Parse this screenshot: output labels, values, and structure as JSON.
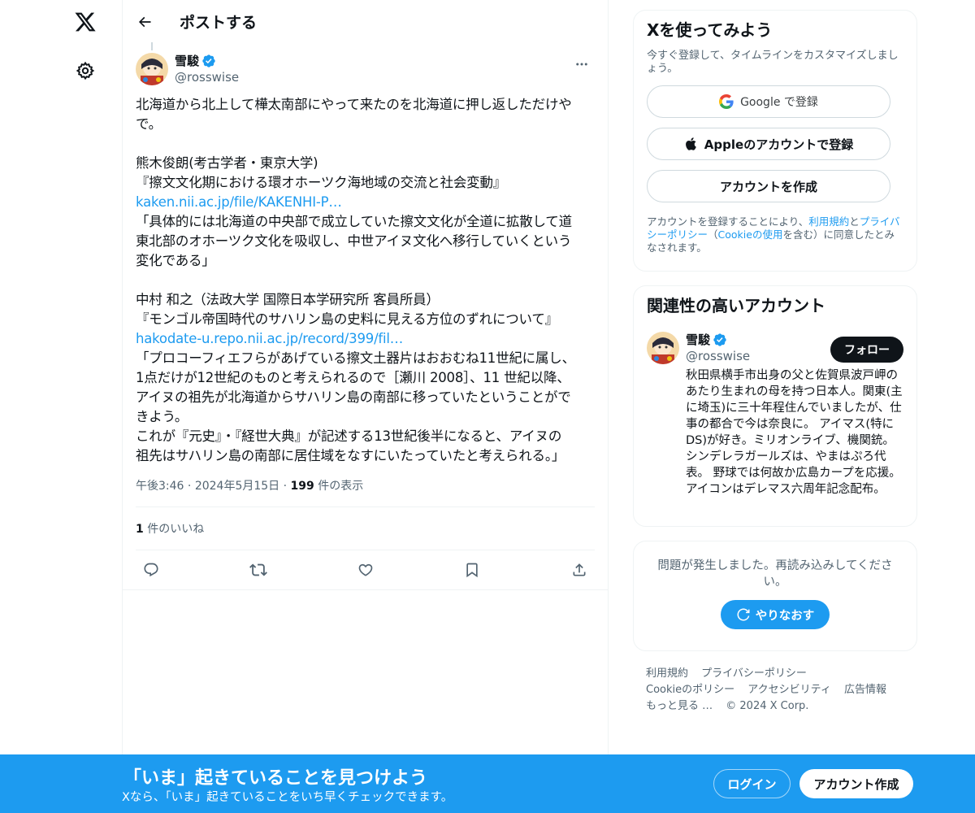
{
  "header": {
    "title": "ポストする"
  },
  "post": {
    "author_name": "雪駿",
    "author_handle": "@rosswise",
    "text_lines": [
      "北海道から北上して樺太南部にやって来たのを北海道に押し返しただけや",
      "で。",
      "",
      "熊木俊朗(考古学者・東京大学)",
      "『擦文文化期における環オホーツク海地域の交流と社会変動』"
    ],
    "link1": "kaken.nii.ac.jp/file/KAKENHI-P…",
    "text_lines2": [
      "「具体的には北海道の中央部で成立していた擦文文化が全道に拡散して道",
      "東北部のオホーツク文化を吸収し、中世アイヌ文化へ移行していくという",
      "変化である」",
      "",
      "中村 和之（法政大学 国際日本学研究所 客員所員）",
      "『モンゴル帝国時代のサハリン島の史料に見える方位のずれについて』"
    ],
    "link2": "hakodate-u.repo.nii.ac.jp/record/399/fil…",
    "text_lines3": [
      "「プロコーフィエフらがあげている擦文土器片はおおむね11世紀に属し、",
      "1点だけが12世紀のものと考えられるので［瀬川 2008］、11 世紀以降、",
      "アイヌの祖先が北海道からサハリン島の南部に移っていたということがで",
      "きよう。",
      "これが『元史』・『経世大典』が記述する13世紀後半になると、アイヌの",
      "祖先はサハリン島の南部に居住域をなすにいたっていたと考えられる。」"
    ],
    "time": "午後3:46",
    "date": "2024年5月15日",
    "views_count": "199",
    "views_label": "件の表示",
    "likes_count": "1",
    "likes_label": "件のいいね"
  },
  "signup": {
    "title": "Xを使ってみよう",
    "subtitle": "今すぐ登録して、タイムラインをカスタマイズしましょう。",
    "google_label": "Google で登録",
    "apple_label": "Appleのアカウントで登録",
    "create_label": "アカウントを作成",
    "legal_prefix": "アカウントを登録することにより、",
    "legal_terms": "利用規約",
    "legal_and": "と",
    "legal_privacy": "プライバシーポリシー",
    "legal_paren_open": "（",
    "legal_cookie": "Cookieの使用",
    "legal_suffix": "を含む）に同意したとみなされます。"
  },
  "related": {
    "title": "関連性の高いアカウント",
    "name": "雪駿",
    "handle": "@rosswise",
    "follow_label": "フォロー",
    "bio": "秋田県横手市出身の父と佐賀県波戸岬のあたり生まれの母を持つ日本人。関東(主に埼玉)に三十年程住んでいましたが、仕事の都合で今は奈良に。 アイマス(特にDS)が好き。ミリオンライブ、機関銃。シンデレラガールズは、やまはぷろ代表。 野球では何故か広島カープを応援。アイコンはデレマス六周年記念配布。"
  },
  "error": {
    "message": "問題が発生しました。再読み込みしてください。",
    "retry_label": "やりなおす"
  },
  "footer": {
    "links_row1": [
      "利用規約",
      "プライバシーポリシー"
    ],
    "links_row2": [
      "Cookieのポリシー",
      "アクセシビリティ",
      "広告情報"
    ],
    "more": "もっと見る …",
    "copyright": "© 2024 X Corp."
  },
  "banner": {
    "title": "「いま」起きていることを見つけよう",
    "subtitle": "Xなら、「いま」起きていることをいち早くチェックできます。",
    "login_label": "ログイン",
    "create_label": "アカウント作成"
  },
  "colors": {
    "accent": "#1d9bf0",
    "text": "#0f1419",
    "muted": "#536471"
  }
}
